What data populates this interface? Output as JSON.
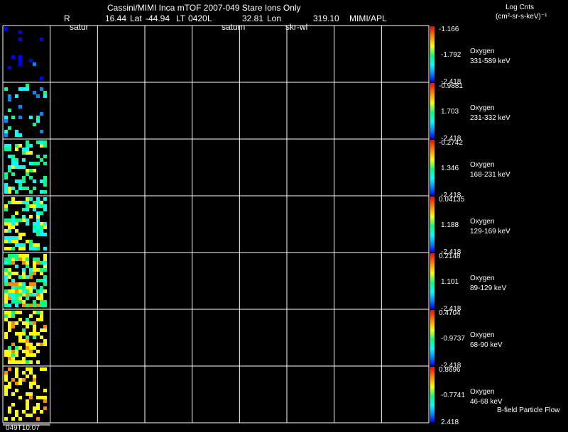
{
  "header": {
    "title": "Cassini/MIMI Inca mTOF  2007-049   Stare    Ions Only",
    "r_label": "R",
    "r_value": "16.44",
    "lat_label": "Lat",
    "lat_value": "-44.94",
    "lt_label": "LT",
    "lt_value": "0420",
    "l_label": "L",
    "l_value": "32.81",
    "lon_label": "Lon",
    "lon_value": "319.10",
    "institution": "MIMI/APL",
    "scale_title": "Log Cnts",
    "scale_units": "(cm²-sr-s-keV)⁻¹"
  },
  "overlay_labels": [
    "satur",
    "saturn",
    "skr-wl"
  ],
  "time_label": "049T10:07",
  "footer_note": "B-field Particle Flow",
  "colors": {
    "background": "#000000",
    "grid": "#ffffff",
    "colorbar": [
      "#ff0000",
      "#ff8800",
      "#ffff00",
      "#00ff88",
      "#00ffff",
      "#0088ff",
      "#0000ff"
    ]
  },
  "chart_data": {
    "type": "heatmap",
    "grid_columns": 9,
    "panels": [
      {
        "species": "Oxygen",
        "energy": "331-589 keV",
        "scale_max": "-1.166",
        "scale_mid": "-1.792",
        "scale_min": "-2.418"
      },
      {
        "species": "Oxygen",
        "energy": "231-332 keV",
        "scale_max": "-0.9881",
        "scale_mid": "1.703",
        "scale_min": "-2.418"
      },
      {
        "species": "Oxygen",
        "energy": "168-231 keV",
        "scale_max": "-0.2742",
        "scale_mid": "1.346",
        "scale_min": "-2.418"
      },
      {
        "species": "Oxygen",
        "energy": "129-169 keV",
        "scale_max": "0.04135",
        "scale_mid": "1.188",
        "scale_min": "-2.418"
      },
      {
        "species": "Oxygen",
        "energy": "89-129 keV",
        "scale_max": "0.2148",
        "scale_mid": "1.101",
        "scale_min": "-2.418"
      },
      {
        "species": "Oxygen",
        "energy": "68-90 keV",
        "scale_max": "0.4704",
        "scale_mid": "-0.9737",
        "scale_min": "-2.418"
      },
      {
        "species": "Oxygen",
        "energy": "46-68 keV",
        "scale_max": "0.8696",
        "scale_mid": "-0.7741",
        "scale_min": "2.418"
      }
    ]
  }
}
